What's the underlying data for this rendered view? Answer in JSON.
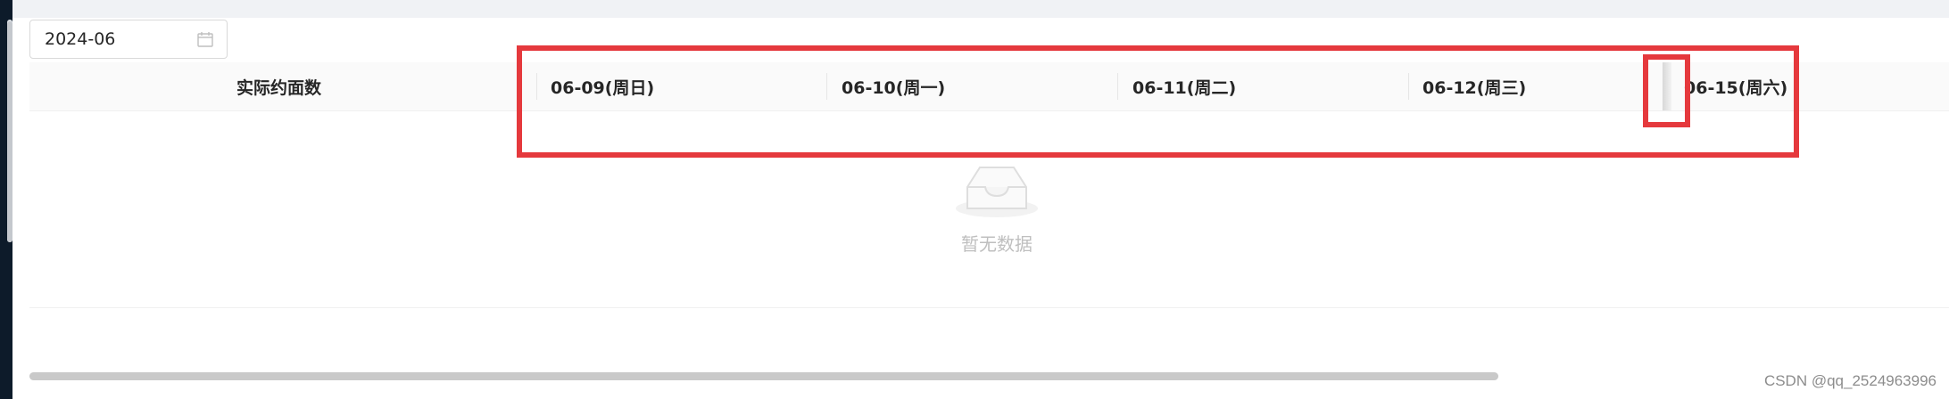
{
  "date_picker": {
    "value": "2024-06",
    "icon": "calendar-icon"
  },
  "table": {
    "columns": [
      {
        "label": "实际约面数"
      },
      {
        "label": "06-09(周日)"
      },
      {
        "label": "06-10(周一)"
      },
      {
        "label": "06-11(周二)"
      },
      {
        "label": "06-12(周三)"
      },
      {
        "label": "06-15(周六)"
      }
    ],
    "empty": {
      "text": "暂无数据",
      "icon": "empty-inbox-icon"
    }
  },
  "annotations": {
    "color": "#e5393d"
  },
  "watermark": "CSDN @qq_2524963996"
}
